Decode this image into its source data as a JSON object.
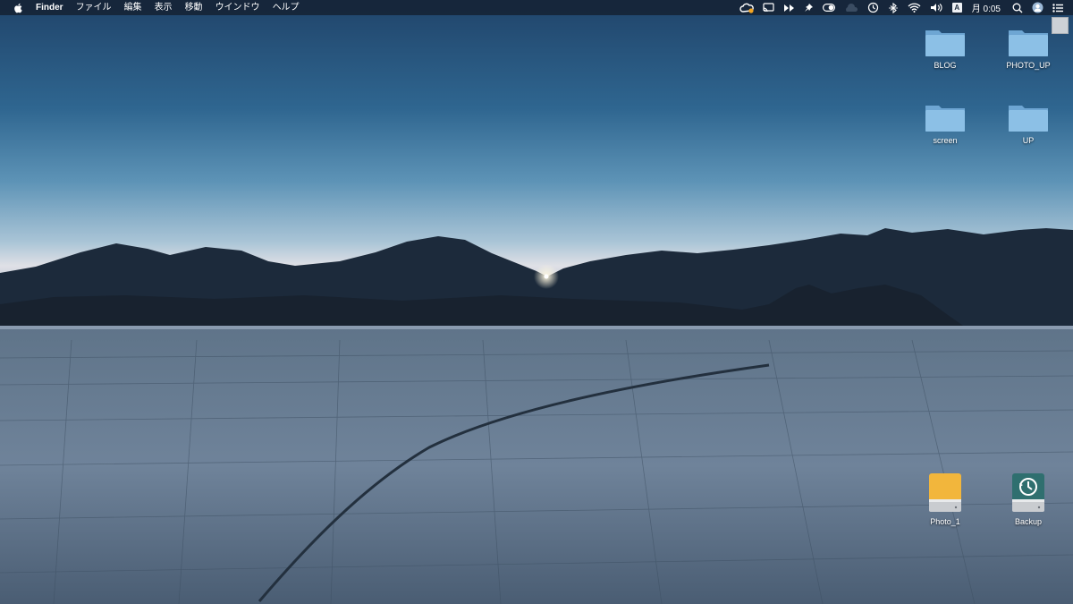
{
  "menubar": {
    "app_name": "Finder",
    "menus": [
      "ファイル",
      "編集",
      "表示",
      "移動",
      "ウインドウ",
      "ヘルプ"
    ],
    "status_icons": [
      "creative-cloud-icon",
      "cast-icon",
      "fast-forward-icon",
      "pin-icon",
      "toggle-icon",
      "cloud-icon",
      "time-machine-icon",
      "bluetooth-icon",
      "wifi-icon",
      "volume-icon"
    ],
    "input_source": "A",
    "clock": "月 0:05"
  },
  "desktop": {
    "folders": [
      {
        "label": "BLOG"
      },
      {
        "label": "PHOTO_UP"
      },
      {
        "label": "screen"
      },
      {
        "label": "UP"
      }
    ],
    "drives": [
      {
        "label": "Photo_1",
        "color": "#f2b63c"
      },
      {
        "label": "Backup",
        "color": "#2f6f6f"
      }
    ]
  },
  "colors": {
    "menubar": "#142234",
    "folder": "#7fb3dc"
  }
}
